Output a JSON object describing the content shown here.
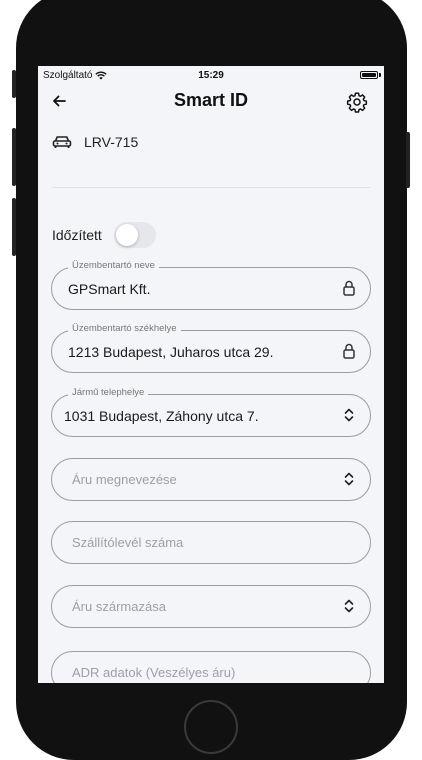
{
  "status_bar": {
    "carrier": "Szolgáltató",
    "time": "15:29",
    "wifi_icon": "wifi-icon",
    "battery_level": 1.0
  },
  "header": {
    "title": "Smart ID",
    "back_icon": "arrow-left-icon",
    "settings_icon": "gear-icon"
  },
  "vehicle": {
    "plate": "LRV-715",
    "icon": "car-icon"
  },
  "toggle": {
    "label": "Időzített",
    "on": false
  },
  "fields": [
    {
      "label": "Üzembentartó neve",
      "value": "GPSmart Kft.",
      "icon": "lock-icon"
    },
    {
      "label": "Üzembentartó székhelye",
      "value": "1213 Budapest, Juharos utca 29.",
      "icon": "lock-icon"
    },
    {
      "label": "Jármű telephelye",
      "value": "1031 Budapest, Záhony utca 7.",
      "icon": "chevron-up-down-icon"
    },
    {
      "placeholder": "Áru megnevezése",
      "icon": "chevron-up-down-icon"
    },
    {
      "placeholder": "Szállítólevél száma"
    },
    {
      "placeholder": "Áru származása",
      "icon": "chevron-up-down-icon"
    },
    {
      "placeholder": "ADR adatok (Veszélyes áru)"
    }
  ]
}
